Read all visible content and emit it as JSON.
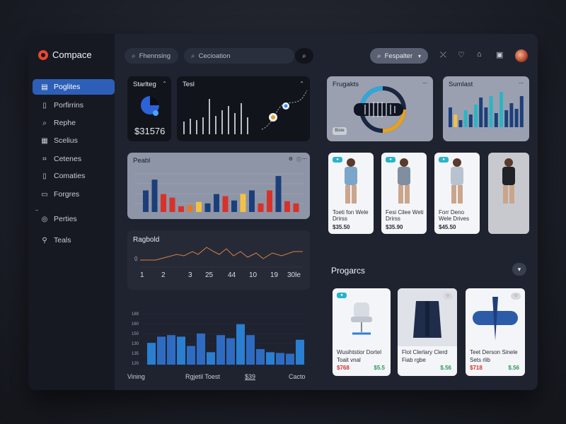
{
  "app": {
    "title": "Compace"
  },
  "sidebar": {
    "items": [
      {
        "label": "Poglites",
        "icon": "document-icon",
        "glyph": "▤",
        "active": true
      },
      {
        "label": "Porfirrins",
        "icon": "file-icon",
        "glyph": "▯"
      },
      {
        "label": "Rephe",
        "icon": "search-icon",
        "glyph": "⌕"
      },
      {
        "label": "Scelius",
        "icon": "list-icon",
        "glyph": "▦"
      },
      {
        "label": "Cetenes",
        "icon": "tag-icon",
        "glyph": "⌗"
      },
      {
        "label": "Comaties",
        "icon": "doc-icon",
        "glyph": "▯"
      },
      {
        "label": "Forgres",
        "icon": "chat-icon",
        "glyph": "▭"
      },
      {
        "label": "Perties",
        "icon": "globe-icon",
        "glyph": "◎"
      },
      {
        "label": "Teals",
        "icon": "wrench-icon",
        "glyph": "⚲"
      }
    ]
  },
  "topbar": {
    "search1_value": "Fhennsing",
    "search2_value": "Cecioation",
    "filter_label": "Fespalter",
    "icons": {
      "a": "tools-icon",
      "b": "heart-icon",
      "c": "bag-icon",
      "d": "clipboard-icon"
    }
  },
  "cards": {
    "stat": {
      "title": "Starlteg",
      "value": "$31576"
    },
    "text": {
      "title": "Tesl"
    },
    "bars": {
      "title": "Peabl"
    },
    "line": {
      "title": "Ragbold",
      "axis": [
        "1",
        "2",
        "3",
        "25",
        "44",
        "10",
        "19",
        "30le"
      ],
      "yzero": "0"
    },
    "bottom": {
      "ylabels": [
        "189",
        "160",
        "150",
        "130",
        "135",
        "120"
      ],
      "footer": [
        "Vining",
        "Rgjetil Toest",
        "$39",
        "Cacto"
      ]
    },
    "products": {
      "title": "Frugakts",
      "btn": "Biste"
    },
    "sumlest": {
      "title": "Sumlast"
    }
  },
  "fashion": [
    {
      "name": "Toeti fon Wele Drirss",
      "price": "$35.50"
    },
    {
      "name": "Fesi Cilee Weti Drirss",
      "price": "$35.90"
    },
    {
      "name": "Forr Deno Wele Drives",
      "price": "$45.50"
    },
    {
      "name": "",
      "price": ""
    }
  ],
  "progress_section": {
    "title": "Progarcs"
  },
  "catalog": [
    {
      "name": "Wusihtstior Dortel",
      "sub": "Toait vnal",
      "price_a": "$768",
      "price_b": "$5.5"
    },
    {
      "name": "Flot Clerlary Clerd",
      "sub": "Fiab rgbe",
      "price_a": "",
      "price_b": "$.56"
    },
    {
      "name": "Teet Derson Sinele",
      "sub": "Sets rlib",
      "price_a": "$718",
      "price_b": "$.56"
    }
  ],
  "chart_data": [
    {
      "type": "bar",
      "title": "Peabl",
      "values": [
        30,
        45,
        25,
        20,
        8,
        10,
        14,
        12,
        25,
        22,
        16,
        25,
        30,
        12,
        30,
        50,
        15,
        12
      ],
      "series_colors": [
        "#1c3f7a",
        "#1c3f7a",
        "#d6322b",
        "#d6322b",
        "#d6322b",
        "#e07a2f",
        "#f3c144",
        "#1c3f7a",
        "#1c3f7a",
        "#d6322b",
        "#1c3f7a",
        "#f3c144",
        "#1c3f7a",
        "#d6322b",
        "#d6322b",
        "#1c3f7a",
        "#d6322b",
        "#d6322b"
      ]
    },
    {
      "type": "bar",
      "title": "",
      "ylabels": [
        "189",
        "160",
        "150",
        "130",
        "135",
        "120"
      ],
      "values": [
        28,
        36,
        38,
        36,
        24,
        40,
        16,
        38,
        34,
        52,
        38,
        20,
        16,
        15,
        14,
        32
      ],
      "ylim": [
        0,
        60
      ]
    }
  ]
}
